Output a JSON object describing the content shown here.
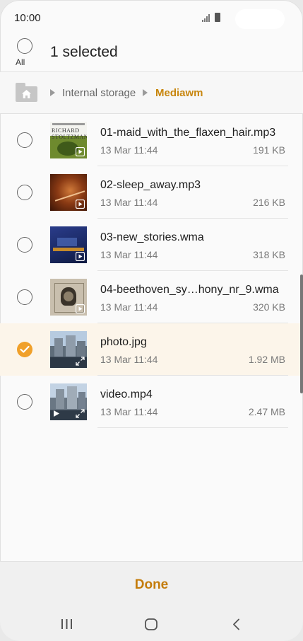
{
  "status_bar": {
    "time": "10:00"
  },
  "header": {
    "select_all_label": "All",
    "title": "1 selected"
  },
  "breadcrumb": {
    "items": [
      "Internal storage",
      "Mediawm"
    ]
  },
  "files": [
    {
      "name": "01-maid_with_the_flaxen_hair.mp3",
      "date": "13 Mar 11:44",
      "size": "191 KB",
      "selected": false,
      "thumb_text": "RICHARD STOLTZMAN"
    },
    {
      "name": "02-sleep_away.mp3",
      "date": "13 Mar 11:44",
      "size": "216 KB",
      "selected": false
    },
    {
      "name": "03-new_stories.wma",
      "date": "13 Mar 11:44",
      "size": "318 KB",
      "selected": false
    },
    {
      "name": "04-beethoven_sy…hony_nr_9.wma",
      "date": "13 Mar 11:44",
      "size": "320 KB",
      "selected": false
    },
    {
      "name": "photo.jpg",
      "date": "13 Mar 11:44",
      "size": "1.92 MB",
      "selected": true
    },
    {
      "name": "video.mp4",
      "date": "13 Mar 11:44",
      "size": "2.47 MB",
      "selected": false
    }
  ],
  "footer": {
    "done_label": "Done"
  },
  "colors": {
    "accent": "#c47c0b",
    "check": "#f0a02a",
    "selected_row": "#fcf5ea"
  }
}
